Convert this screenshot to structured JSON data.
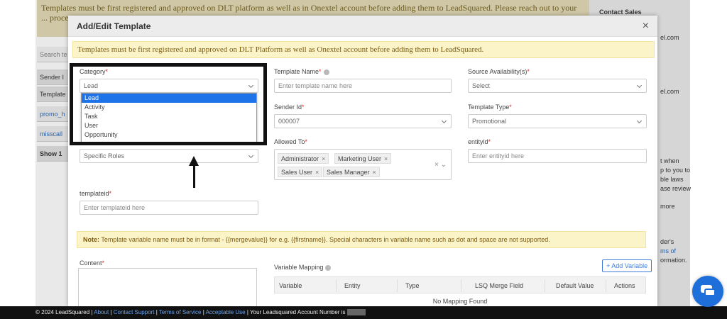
{
  "background": {
    "banner_text": "Templates must be first registered and approved on DLT platform as well as in Onextel account before adding them to LeadSquared. Please reach out to your ... process...",
    "side_contact_sales": "Contact Sales",
    "side_frag_1": "el.com",
    "side_frag_2": "el.com",
    "side_frag_3": "t when",
    "side_frag_4": "p to you to",
    "side_frag_5": "ble laws",
    "side_frag_6": "ase review",
    "side_frag_7": "more",
    "side_frag_8": "der's",
    "side_frag_9": "ms of",
    "side_frag_10": "ormation.",
    "search_placeholder": "Search te",
    "left_rows": [
      "Sender I",
      "Template",
      "promo_h",
      "misscall",
      "Show 1"
    ]
  },
  "modal": {
    "title": "Add/Edit Template",
    "close": "×",
    "warning": "Templates must be first registered and approved on DLT Platform as well as Onextel account before adding them to LeadSquared.",
    "category": {
      "label": "Category",
      "value": "Lead",
      "options": [
        "Lead",
        "Activity",
        "Task",
        "User",
        "Opportunity"
      ]
    },
    "availability_value": "Specific Roles",
    "template_name": {
      "label": "Template Name",
      "placeholder": "Enter template name here"
    },
    "source_availability": {
      "label": "Source Availability(s)",
      "value": "Select"
    },
    "sender_id": {
      "label": "Sender Id",
      "value": "000007"
    },
    "template_type": {
      "label": "Template Type",
      "value": "Promotional"
    },
    "allowed_to": {
      "label": "Allowed To",
      "tags": [
        "Administrator",
        "Marketing User",
        "Sales User",
        "Sales Manager"
      ],
      "clear": "×"
    },
    "entityid": {
      "label": "entityid",
      "placeholder": "Enter entityid here"
    },
    "templateid": {
      "label": "templateid",
      "placeholder": "Enter templateid here"
    },
    "note_bold": "Note:",
    "note_text": "Template variable name must be in format - {{mergevalue}} for e.g. {{firstname}}. Special characters in variable name such as dot and space are not supported.",
    "content_label": "Content",
    "variable_mapping_label": "Variable Mapping",
    "add_variable": "+ Add Variable",
    "table_headers": [
      "Variable",
      "Entity",
      "Type",
      "LSQ Merge Field",
      "Default Value",
      "Actions"
    ],
    "no_mapping": "No Mapping Found",
    "required_mark": "*"
  },
  "footer": {
    "copyright": "© 2024 LeadSquared |",
    "links": [
      "About",
      "Contact Support",
      "Terms of Service",
      "Acceptable Use"
    ],
    "sep": "|",
    "account_text": "| Your Leadsquared Account Number is"
  },
  "colors": {
    "accent": "#1e73e8",
    "warning_bg": "#fcf4c9",
    "required": "#d9302c"
  }
}
